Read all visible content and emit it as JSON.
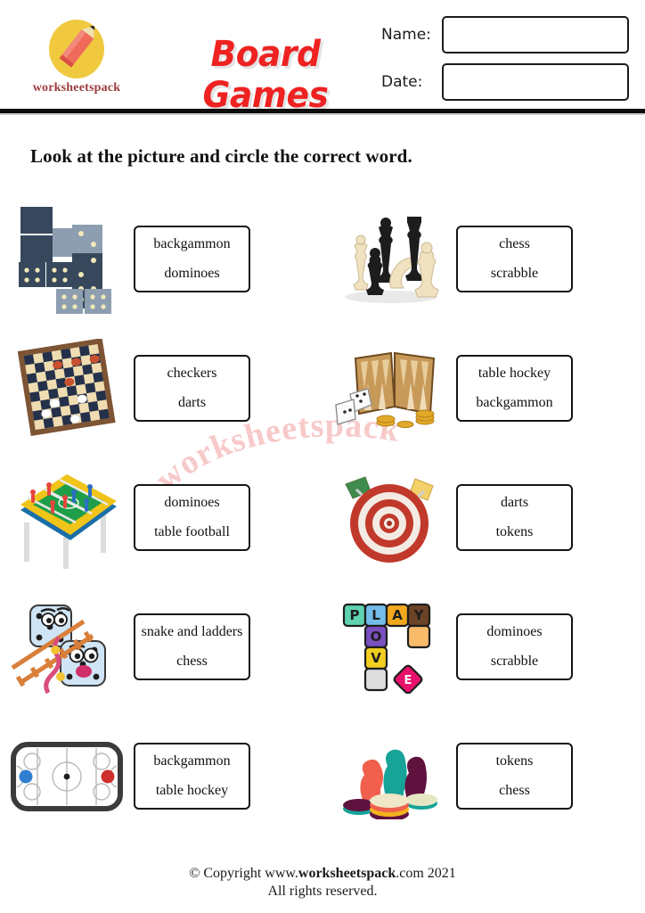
{
  "header": {
    "logo_text": "worksheetspack",
    "logo_icon": "pencil-in-circle-icon",
    "title": "Board Games",
    "title_color": "#ef2222",
    "name_label": "Name:",
    "date_label": "Date:",
    "name_value": "",
    "date_value": ""
  },
  "instruction": "Look at the picture and circle the correct word.",
  "watermark": "worksheetspack",
  "exercises": [
    {
      "picture": "dominoes-picture",
      "option_a": "backgammon",
      "option_b": "dominoes"
    },
    {
      "picture": "chess-pieces-picture",
      "option_a": "chess",
      "option_b": "scrabble"
    },
    {
      "picture": "checkers-board-picture",
      "option_a": "checkers",
      "option_b": "darts"
    },
    {
      "picture": "backgammon-board-picture",
      "option_a": "table hockey",
      "option_b": "backgammon"
    },
    {
      "picture": "table-football-picture",
      "option_a": "dominoes",
      "option_b": "table football"
    },
    {
      "picture": "dartboard-picture",
      "option_a": "darts",
      "option_b": "tokens"
    },
    {
      "picture": "snake-and-ladders-picture",
      "option_a": "snake and ladders",
      "option_b": "chess"
    },
    {
      "picture": "scrabble-tiles-picture",
      "option_a": "dominoes",
      "option_b": "scrabble"
    },
    {
      "picture": "table-hockey-picture",
      "option_a": "backgammon",
      "option_b": "table hockey"
    },
    {
      "picture": "tokens-picture",
      "option_a": "tokens",
      "option_b": "chess"
    }
  ],
  "footer": {
    "copyright_prefix": "©  Copyright www.",
    "copyright_site": "worksheetspack",
    "copyright_suffix": ".com 2021",
    "rights": "All rights reserved."
  }
}
